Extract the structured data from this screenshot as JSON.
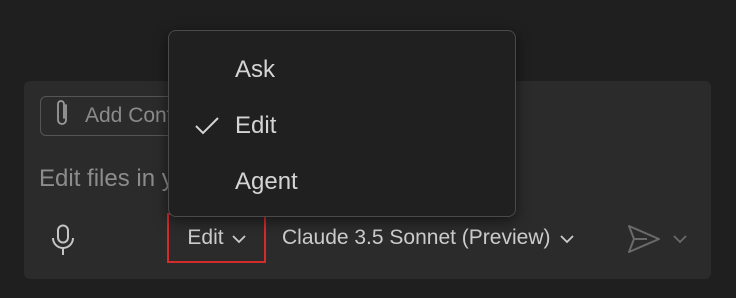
{
  "input": {
    "add_context_label": "Add Context...",
    "placeholder": "Edit files in your workspace"
  },
  "toolbar": {
    "mode_label": "Edit",
    "model_label": "Claude 3.5 Sonnet (Preview)"
  },
  "mode_menu": {
    "items": [
      {
        "label": "Ask",
        "checked": false
      },
      {
        "label": "Edit",
        "checked": true
      },
      {
        "label": "Agent",
        "checked": false
      }
    ]
  },
  "colors": {
    "highlight_border": "#d42b2b",
    "panel_bg": "#2b2b2b",
    "menu_bg": "#202020"
  },
  "icons": {
    "attach": "paperclip-icon",
    "mic": "microphone-icon",
    "send": "send-icon",
    "chevron": "chevron-down-icon",
    "check": "check-icon"
  }
}
